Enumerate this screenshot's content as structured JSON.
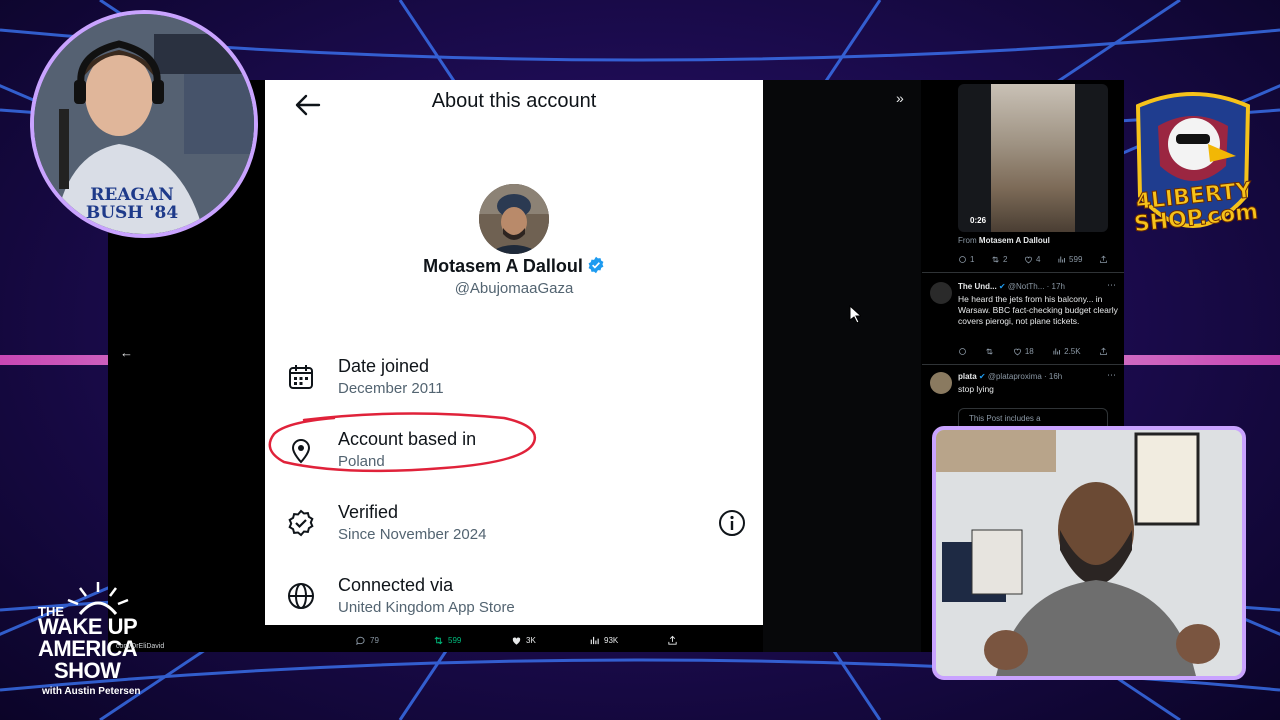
{
  "modal": {
    "title": "About this account",
    "name": "Motasem A Dalloul",
    "handle": "@AbujomaaGaza",
    "rows": [
      {
        "label": "Date joined",
        "value": "December 2011"
      },
      {
        "label": "Account based in",
        "value": "Poland"
      },
      {
        "label": "Verified",
        "value": "Since November 2024"
      },
      {
        "label": "Connected via",
        "value": "United Kingdom App Store"
      }
    ]
  },
  "post_stats": {
    "replies": "79",
    "reposts": "599",
    "likes": "3K",
    "views": "93K"
  },
  "feed": {
    "video_duration": "0:26",
    "from_prefix": "From",
    "from_name": "Motasem A Dalloul",
    "video_actions": {
      "replies": "1",
      "reposts": "2",
      "likes": "4",
      "views": "599"
    },
    "tweet1": {
      "name": "The Und...",
      "handle": "@NotTh...",
      "time": "· 17h",
      "text": "He heard the jets from his balcony... in Warsaw. BBC fact-checking budget clearly covers pierogi, not plane tickets.",
      "actions": {
        "reposts": "",
        "likes": "18",
        "views": "2.5K"
      }
    },
    "tweet2": {
      "name": "plata",
      "handle": "@plataproxima",
      "time": "· 16h",
      "text": "stop lying",
      "quoted": "This Post includes a"
    }
  },
  "overlay": {
    "liberty_line1": "4LIBERTY",
    "liberty_line2": "SHOP.com",
    "show_the": "THE",
    "show_wake": "WAKE UP",
    "show_america": "AMERICA",
    "show_show": "SHOW",
    "show_host": "with Austin Petersen",
    "url": "com/DrEliDavid",
    "shirt_text": "REAGAN BUSH '84"
  },
  "colors": {
    "accent": "#1d9bf0",
    "circle": "#e0223a",
    "frame": "#c9a3ff",
    "retweet_green": "#00ba7c"
  }
}
